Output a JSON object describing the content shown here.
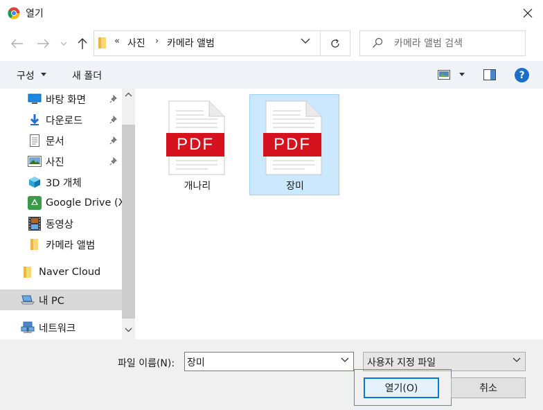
{
  "window": {
    "title": "열기",
    "close_icon": "close-icon"
  },
  "navigation": {
    "back_icon": "arrow-left-icon",
    "forward_icon": "arrow-right-icon",
    "recent_icon": "chevron-down-icon",
    "up_icon": "arrow-up-icon",
    "overflow": "«",
    "breadcrumbs": [
      "사진",
      "카메라 앨범"
    ],
    "separator": "›",
    "refresh_icon": "refresh-icon",
    "search_placeholder": "카메라 앨범 검색"
  },
  "toolbar": {
    "organize_label": "구성",
    "new_folder_label": "새 폴더",
    "view_icon": "view-icon",
    "preview_pane_icon": "preview-pane-icon",
    "help_label": "?"
  },
  "sidebar": {
    "items": [
      {
        "label": "바탕 화면",
        "icon": "desktop-icon",
        "pinned": true
      },
      {
        "label": "다운로드",
        "icon": "download-icon",
        "pinned": true
      },
      {
        "label": "문서",
        "icon": "document-icon",
        "pinned": true
      },
      {
        "label": "사진",
        "icon": "pictures-icon",
        "pinned": true
      },
      {
        "label": "3D 개체",
        "icon": "3d-objects-icon",
        "pinned": false
      },
      {
        "label": "Google Drive (X",
        "icon": "google-drive-icon",
        "pinned": false
      },
      {
        "label": "동영상",
        "icon": "video-icon",
        "pinned": false
      },
      {
        "label": "카메라 앨범",
        "icon": "folder-icon",
        "pinned": false
      },
      {
        "label": "Naver Cloud",
        "icon": "folder-icon",
        "pinned": false
      },
      {
        "label": "내 PC",
        "icon": "computer-icon",
        "pinned": false,
        "selected": true
      },
      {
        "label": "네트워크",
        "icon": "network-icon",
        "pinned": false
      }
    ]
  },
  "files": [
    {
      "name": "개나리",
      "type": "PDF",
      "selected": false
    },
    {
      "name": "장미",
      "type": "PDF",
      "selected": true
    }
  ],
  "footer": {
    "filename_label": "파일 이름(N):",
    "filename_value": "장미",
    "filter_value": "사용자 지정 파일",
    "open_label": "열기(O)",
    "cancel_label": "취소"
  },
  "colors": {
    "pdf_red": "#d7121f",
    "selection_bg": "#cce8ff",
    "accent": "#0078d7",
    "highlight_border": "#e05a3a"
  }
}
